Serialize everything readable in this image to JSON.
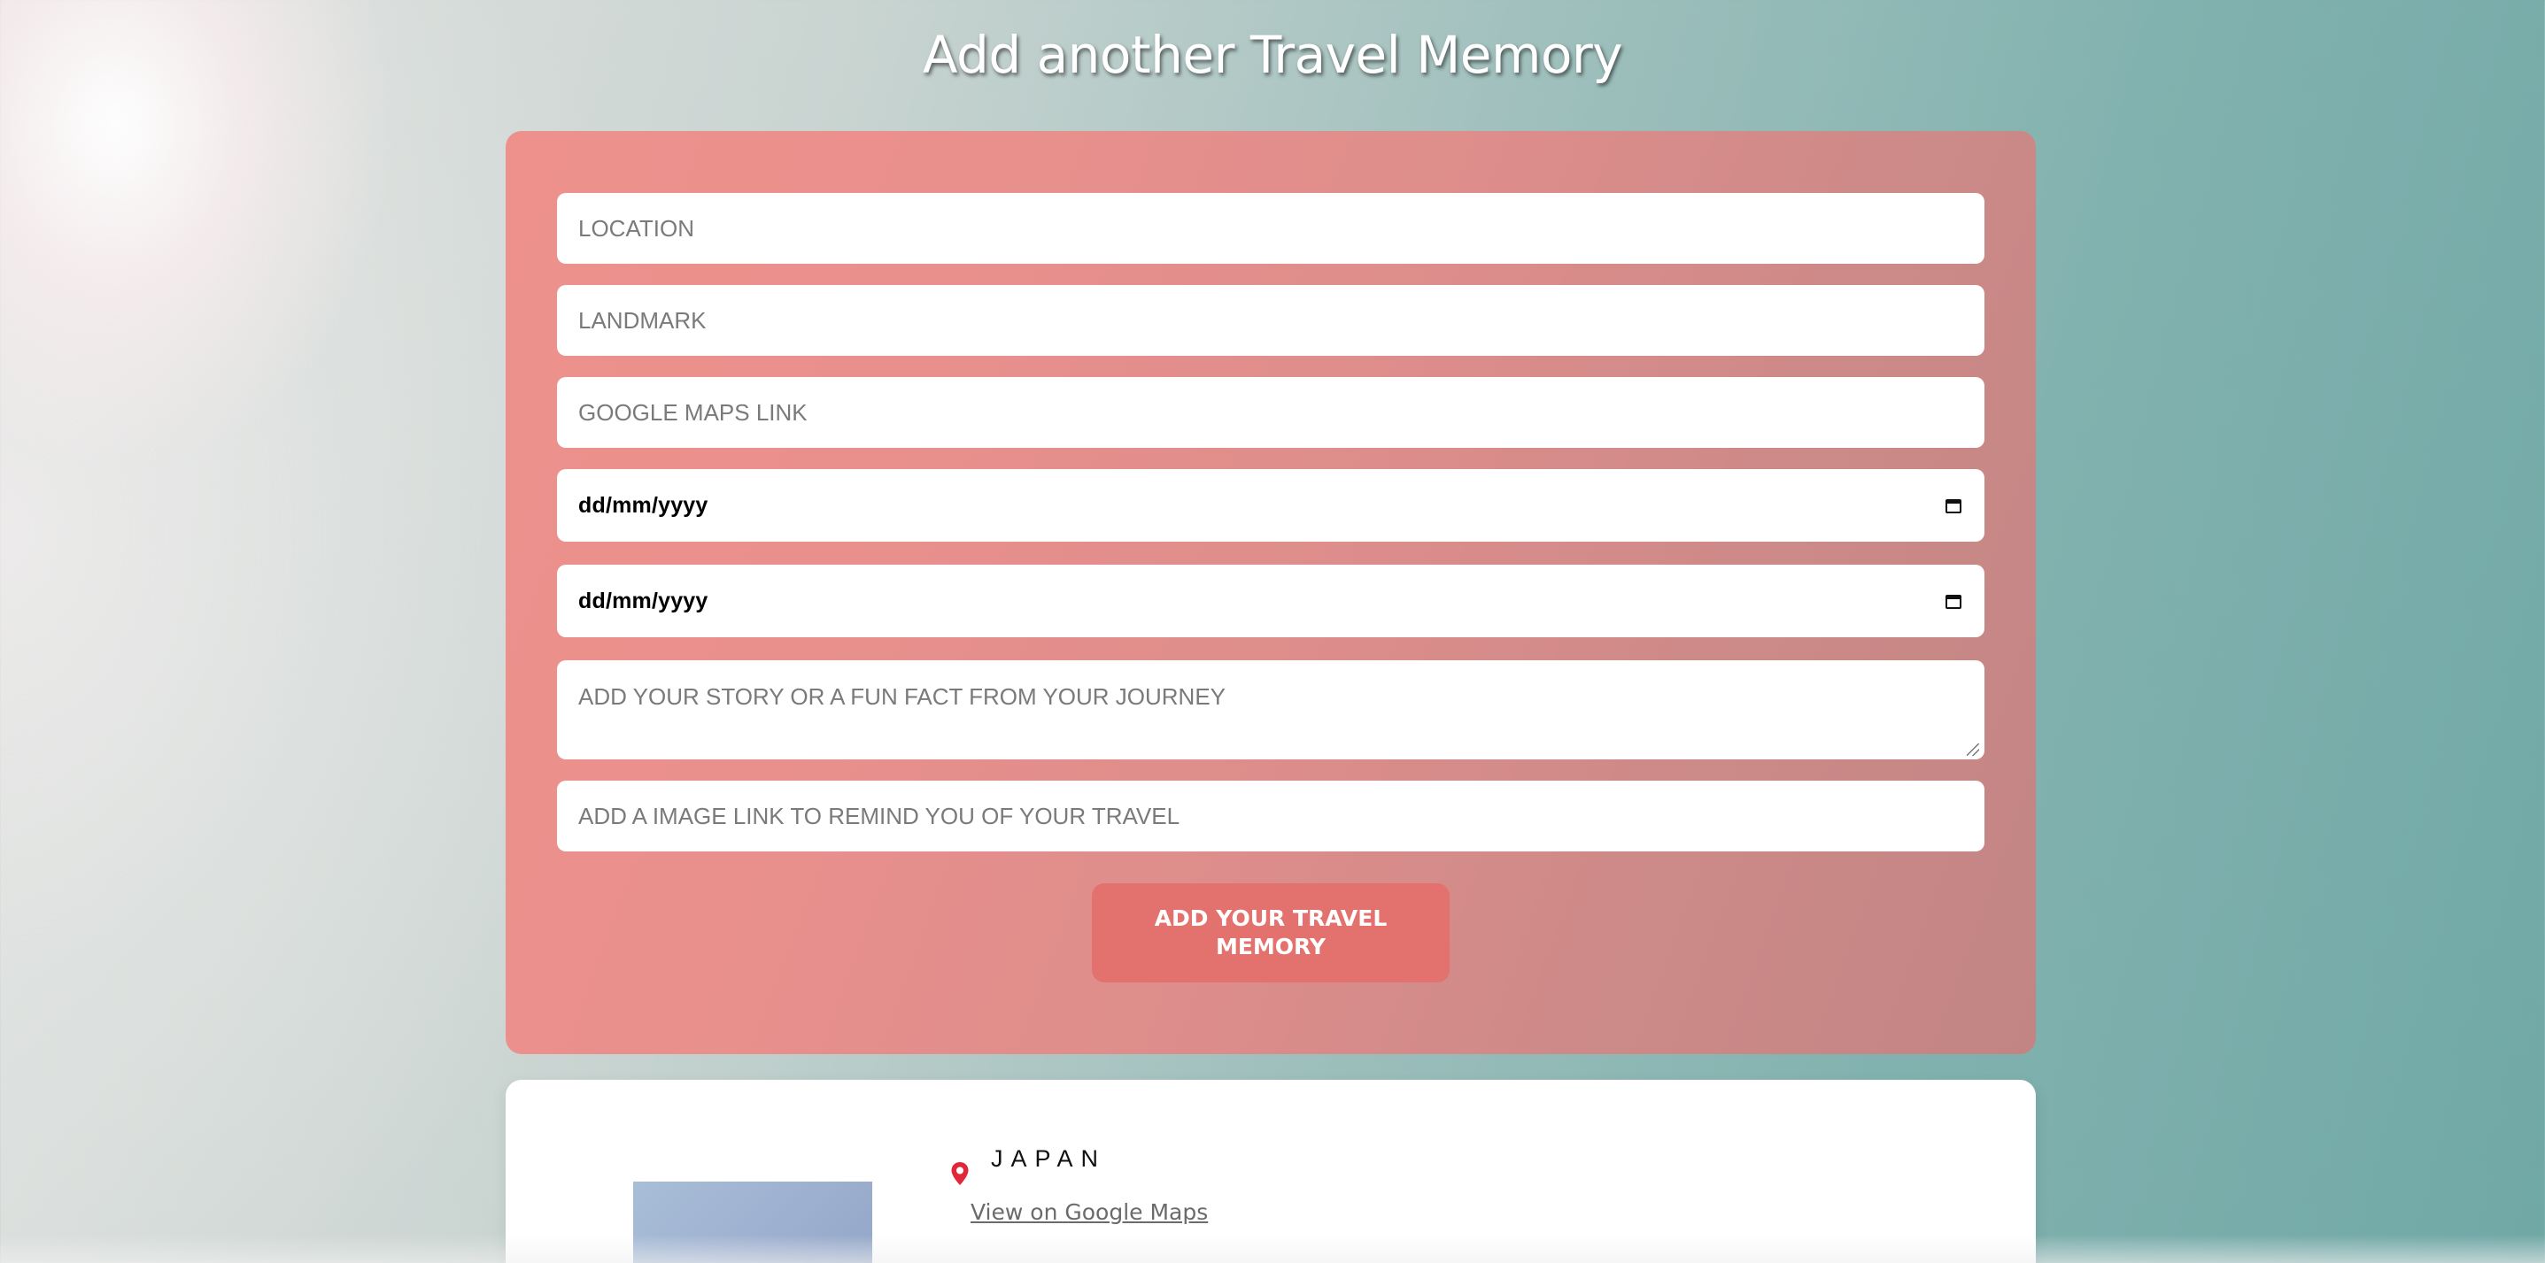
{
  "header": {
    "title": "Add another Travel Memory"
  },
  "form": {
    "location_placeholder": "LOCATION",
    "landmark_placeholder": "LANDMARK",
    "maps_link_placeholder": "GOOGLE MAPS LINK",
    "start_date_placeholder": "dd/mm/yyyy",
    "end_date_placeholder": "dd/mm/yyyy",
    "story_placeholder": "ADD YOUR STORY OR A FUN FACT FROM  YOUR JOURNEY",
    "image_link_placeholder": "ADD A IMAGE LINK TO REMIND YOU OF YOUR TRAVEL",
    "submit_label": "ADD YOUR TRAVEL MEMORY"
  },
  "memory": {
    "location": "JAPAN",
    "maps_link_label": "View on Google Maps"
  },
  "icons": {
    "calendar": "calendar-icon",
    "pin": "map-pin-icon"
  },
  "colors": {
    "form_gradient_start": "#ee918d",
    "form_gradient_end": "#c28584",
    "submit_button": "#e3716d",
    "pin": "#e0283a"
  }
}
